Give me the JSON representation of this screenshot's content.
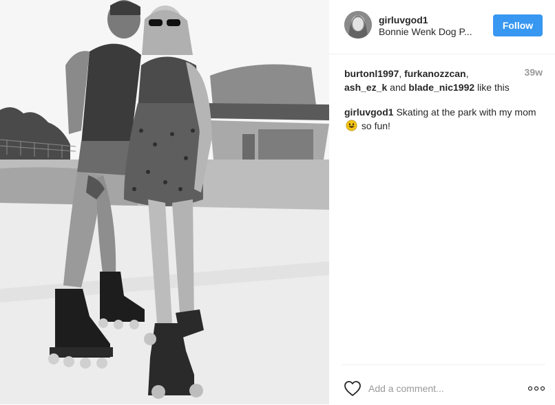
{
  "post": {
    "username": "girluvgod1",
    "location": "Bonnie Wenk Dog P...",
    "follow_label": "Follow",
    "age": "39w",
    "likes": {
      "users": [
        "burtonl1997",
        "furkanozzcan",
        "ash_ez_k",
        "blade_nic1992"
      ],
      "sep1": ", ",
      "sep2": ", ",
      "and": " and ",
      "suffix": " like this"
    },
    "caption": {
      "author": "girluvgod1",
      "text_before": " Skating at the park with my mom ",
      "emoji": "smiley-emoji",
      "text_after": " so fun!"
    },
    "comment_placeholder": "Add a comment...",
    "icons": {
      "like": "heart-icon",
      "more": "more-options-icon"
    },
    "colors": {
      "follow_button": "#3897f0",
      "secondary_text": "#999999",
      "primary_text": "#262626"
    }
  }
}
